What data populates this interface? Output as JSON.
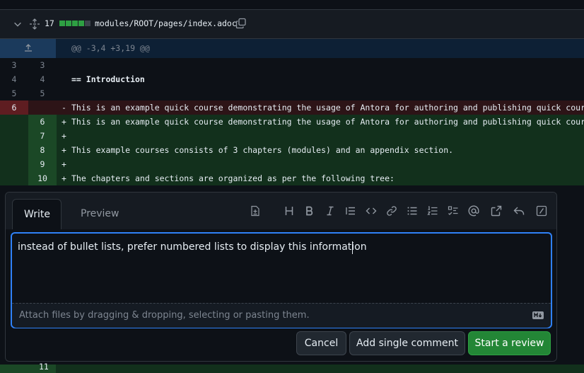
{
  "file": {
    "changed_lines": "17",
    "path": "modules/ROOT/pages/index.adoc",
    "diffstat": [
      "#2ea043",
      "#2ea043",
      "#2ea043",
      "#2ea043",
      "#30363d"
    ]
  },
  "hunk_header": "@@ -3,4 +3,19 @@",
  "lines": [
    {
      "type": "context",
      "old": "3",
      "new": "3",
      "sign": " ",
      "text": ""
    },
    {
      "type": "context",
      "old": "4",
      "new": "4",
      "sign": " ",
      "text": "== Introduction"
    },
    {
      "type": "context",
      "old": "5",
      "new": "5",
      "sign": " ",
      "text": ""
    },
    {
      "type": "del",
      "old": "6",
      "new": "",
      "sign": "-",
      "text": "This is an example quick course demonstrating the usage of Antora for authoring and publishing quick courses."
    },
    {
      "type": "add",
      "old": "",
      "new": "6",
      "sign": "+",
      "text": "This is an example quick course demonstrating the usage of Antora for authoring and publishing quick courses."
    },
    {
      "type": "add",
      "old": "",
      "new": "7",
      "sign": "+",
      "text": ""
    },
    {
      "type": "add",
      "old": "",
      "new": "8",
      "sign": "+",
      "text": "This example courses consists of 3 chapters (modules) and an appendix section."
    },
    {
      "type": "add",
      "old": "",
      "new": "9",
      "sign": "+",
      "text": ""
    },
    {
      "type": "add",
      "old": "",
      "new": "10",
      "sign": "+",
      "text": "The chapters and sections are organized as per the following tree:"
    }
  ],
  "comment": {
    "tabs": {
      "write": "Write",
      "preview": "Preview"
    },
    "text": "instead of bullet lists, prefer numbered lists to display this information",
    "attach_hint": "Attach files by dragging & dropping, selecting or pasting them.",
    "buttons": {
      "cancel": "Cancel",
      "single": "Add single comment",
      "review": "Start a review"
    },
    "toolbar": [
      "add-file-icon",
      "heading-icon",
      "bold-icon",
      "italic-icon",
      "quote-icon",
      "code-icon",
      "link-icon",
      "unordered-list-icon",
      "ordered-list-icon",
      "task-list-icon",
      "mention-icon",
      "cross-reference-icon",
      "reply-icon",
      "slash-command-icon"
    ]
  },
  "bottom_line_number": "11"
}
